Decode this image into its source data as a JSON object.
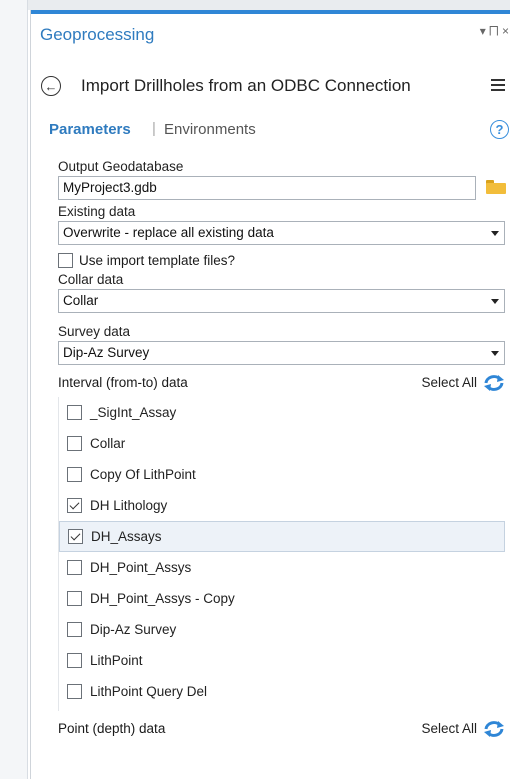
{
  "pane": {
    "title": "Geoprocessing",
    "pin_symbol": "▾ ⨅ ×"
  },
  "tool": {
    "title": "Import Drillholes from an ODBC Connection"
  },
  "tabs": {
    "parameters": "Parameters",
    "separator": "|",
    "environments": "Environments"
  },
  "fields": {
    "output_geodatabase": {
      "label": "Output Geodatabase",
      "value": "MyProject3.gdb"
    },
    "existing_data": {
      "label": "Existing data",
      "value": "Overwrite - replace all existing data"
    },
    "use_template": {
      "label": "Use import template files?",
      "checked": false
    },
    "collar_data": {
      "label": "Collar data",
      "value": "Collar"
    },
    "survey_data": {
      "label": "Survey data",
      "value": "Dip-Az Survey"
    }
  },
  "interval": {
    "label": "Interval (from-to) data",
    "select_all": "Select All",
    "items": [
      {
        "label": "_SigInt_Assay",
        "checked": false
      },
      {
        "label": "Collar",
        "checked": false
      },
      {
        "label": "Copy Of LithPoint",
        "checked": false
      },
      {
        "label": "DH Lithology",
        "checked": true
      },
      {
        "label": "DH_Assays",
        "checked": true
      },
      {
        "label": "DH_Point_Assys",
        "checked": false
      },
      {
        "label": "DH_Point_Assys - Copy",
        "checked": false
      },
      {
        "label": "Dip-Az Survey",
        "checked": false
      },
      {
        "label": "LithPoint",
        "checked": false
      },
      {
        "label": "LithPoint Query Del",
        "checked": false
      }
    ]
  },
  "point": {
    "label": "Point (depth) data",
    "select_all": "Select All"
  },
  "colors": {
    "accent": "#2f7bbf",
    "highlight": "#edf2f8",
    "folder": "#f2bd3a"
  }
}
